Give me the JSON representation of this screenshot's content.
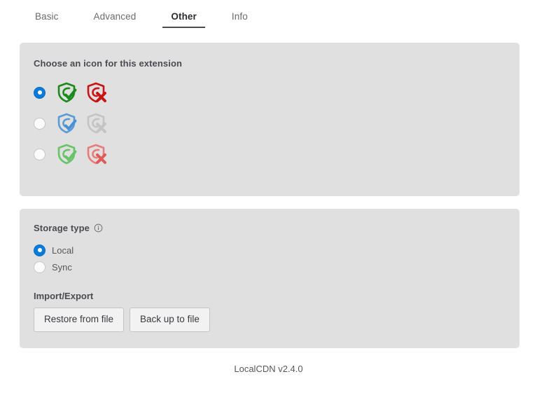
{
  "tabs": [
    {
      "label": "Basic",
      "active": false
    },
    {
      "label": "Advanced",
      "active": false
    },
    {
      "label": "Other",
      "active": true
    },
    {
      "label": "Info",
      "active": false
    }
  ],
  "icon_section": {
    "title": "Choose an icon for this extension",
    "options": [
      {
        "selected": true,
        "shield_on_color": "#1a8a1a",
        "shield_off_color": "#c81414",
        "check_color": "#1a8a1a",
        "cross_color": "#c81414"
      },
      {
        "selected": false,
        "shield_on_color": "#5b9bd5",
        "shield_off_color": "#bdbdbd",
        "check_color": "#4a90d9",
        "cross_color": "#bdbdbd"
      },
      {
        "selected": false,
        "shield_on_color": "#68c468",
        "shield_off_color": "#e87b7b",
        "check_color": "#68c468",
        "cross_color": "#e05a5a"
      }
    ]
  },
  "storage_section": {
    "title": "Storage type",
    "info_tooltip": "i",
    "options": [
      {
        "label": "Local",
        "selected": true
      },
      {
        "label": "Sync",
        "selected": false
      }
    ]
  },
  "import_export": {
    "title": "Import/Export",
    "restore_label": "Restore from file",
    "backup_label": "Back up to file"
  },
  "footer": {
    "text": "LocalCDN v2.4.0"
  },
  "colors": {
    "panel_bg": "#e0e0e0",
    "accent": "#0a7bdb",
    "page_bg": "#ffffff",
    "text": "#38383d"
  }
}
